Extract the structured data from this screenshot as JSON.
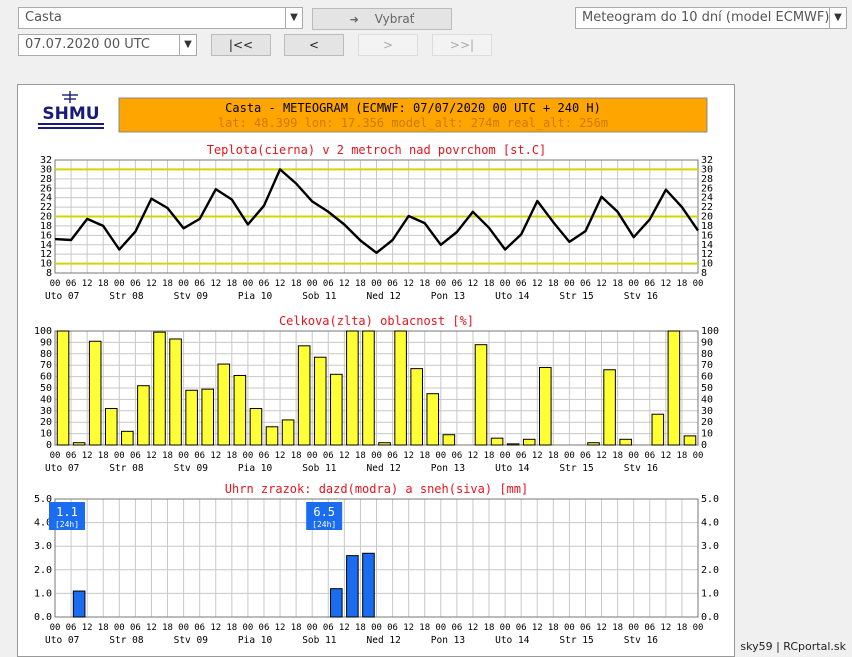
{
  "controls": {
    "location": "Casta",
    "go_button": "Vybrať",
    "product": "Meteogram do 10 dní (model ECMWF)",
    "datetime": "07.07.2020 00 UTC",
    "first": "|<<",
    "prev": "<",
    "next": ">",
    "last": ">>|"
  },
  "header": {
    "logo": "SHMU",
    "title": "Casta - METEOGRAM (ECMWF: 07/07/2020 00 UTC + 240 H)",
    "subtitle": "lat: 48.399  lon: 17.356  model_alt: 274m  real_alt: 256m"
  },
  "time_axis": {
    "hour_labels": [
      "00",
      "06",
      "12",
      "18",
      "00",
      "06",
      "12",
      "18",
      "00",
      "06",
      "12",
      "18",
      "00",
      "06",
      "12",
      "18",
      "00",
      "06",
      "12",
      "18",
      "00",
      "06",
      "12",
      "18",
      "00",
      "06",
      "12",
      "18",
      "00",
      "06",
      "12",
      "18",
      "00",
      "06",
      "12",
      "18",
      "00",
      "06",
      "12",
      "18",
      "00"
    ],
    "day_labels": [
      "Uto 07",
      "Str 08",
      "Stv 09",
      "Pia 10",
      "Sob 11",
      "Ned 12",
      "Pon 13",
      "Uto 14",
      "Str 15",
      "Stv 16"
    ]
  },
  "chart_data": [
    {
      "type": "line",
      "title": "Teplota(cierna) v 2 metroch nad povrchom [st.C]",
      "ylim": [
        8,
        32
      ],
      "yticks": [
        8,
        10,
        12,
        14,
        16,
        18,
        20,
        22,
        24,
        26,
        28,
        30,
        32
      ],
      "highlight_lines": [
        10,
        20,
        30
      ],
      "highlight_color": "#d4d400",
      "series": [
        {
          "color": "#000000",
          "values": [
            15.2,
            15.0,
            19.5,
            18.0,
            13.0,
            16.8,
            23.8,
            21.8,
            17.5,
            19.5,
            25.8,
            23.6,
            18.3,
            22.3,
            30.0,
            27.0,
            23.2,
            21.0,
            18.3,
            14.9,
            12.3,
            15.0,
            20.1,
            18.6,
            14.0,
            16.7,
            21.0,
            17.6,
            13.0,
            16.2,
            23.3,
            18.8,
            14.6,
            16.9,
            24.2,
            21.0,
            15.6,
            19.4,
            25.7,
            22.0,
            17.0
          ]
        }
      ]
    },
    {
      "type": "bar",
      "title": "Celkova(zlta) oblacnost [%]",
      "ylim": [
        0,
        100
      ],
      "yticks": [
        0,
        10,
        20,
        30,
        40,
        50,
        60,
        70,
        80,
        90,
        100
      ],
      "color": "#ffff33",
      "values": [
        100,
        2,
        91,
        32,
        12,
        52,
        99,
        93,
        48,
        49,
        71,
        61,
        32,
        16,
        22,
        87,
        77,
        62,
        100,
        100,
        2,
        100,
        67,
        45,
        9,
        0,
        88,
        6,
        1,
        5,
        68,
        0,
        0,
        2,
        66,
        5,
        0,
        27,
        100,
        8
      ]
    },
    {
      "type": "bar",
      "title": "Uhrn zrazok: dazd(modra) a sneh(siva) [mm]",
      "ylim": [
        0,
        5.0
      ],
      "yticks": [
        "0.0",
        "1.0",
        "2.0",
        "3.0",
        "4.0",
        "5.0"
      ],
      "rain_color": "#1a6cf0",
      "snow_color": "#aaaaaa",
      "rain": [
        0,
        1.1,
        0,
        0,
        0,
        0,
        0,
        0,
        0,
        0,
        0,
        0,
        0,
        0,
        0,
        0,
        0,
        1.2,
        2.6,
        2.7,
        0,
        0,
        0,
        0,
        0,
        0,
        0,
        0,
        0,
        0,
        0,
        0,
        0,
        0,
        0,
        0,
        0,
        0,
        0,
        0
      ],
      "snow": [
        0,
        0,
        0,
        0,
        0,
        0,
        0,
        0,
        0,
        0,
        0,
        0,
        0,
        0,
        0,
        0,
        0,
        0,
        0,
        0,
        0,
        0,
        0,
        0,
        0,
        0,
        0,
        0,
        0,
        0,
        0,
        0,
        0,
        0,
        0,
        0,
        0,
        0,
        0,
        0
      ],
      "daily_totals": [
        {
          "value": "1.1",
          "period": "[24h]",
          "day_index": 0
        },
        {
          "value": "6.5",
          "period": "[24h]",
          "day_index": 4
        }
      ]
    }
  ],
  "credit": "sky59 | RCportal.sk"
}
